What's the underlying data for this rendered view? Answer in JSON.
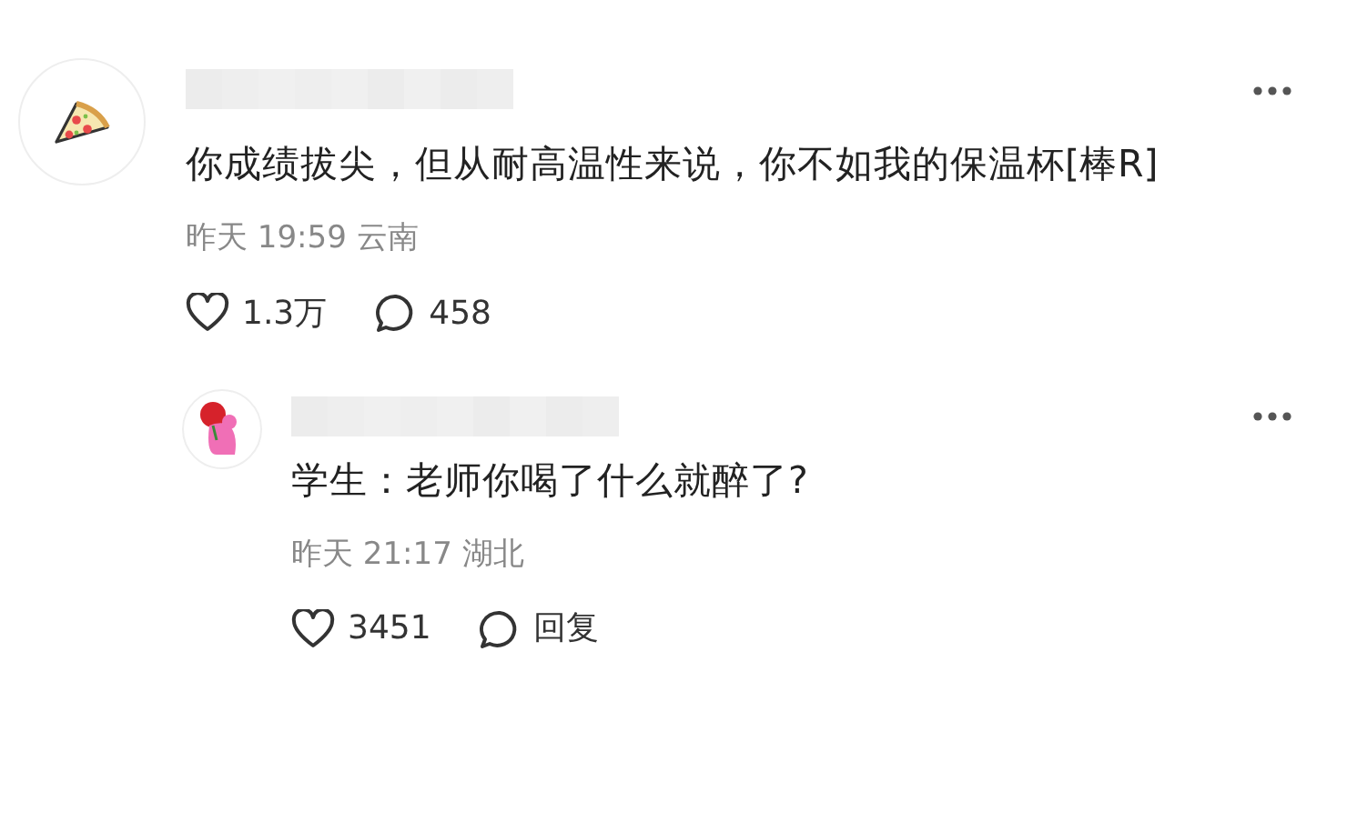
{
  "comments": [
    {
      "avatar": {
        "kind": "pizza"
      },
      "username": {
        "kind": "redacted"
      },
      "text": "你成绩拔尖，但从耐高温性来说，你不如我的保温杯[棒R]",
      "meta": "昨天 19:59 云南",
      "actions": [
        {
          "kind": "like",
          "label": "1.3万"
        },
        {
          "kind": "comment",
          "label": "458"
        }
      ],
      "replies": [
        {
          "avatar": {
            "kind": "rose"
          },
          "username": {
            "kind": "redacted"
          },
          "text": "学生：老师你喝了什么就醉了?",
          "meta": "昨天 21:17 湖北",
          "actions": [
            {
              "kind": "like",
              "label": "3451"
            },
            {
              "kind": "comment",
              "label": "回复"
            }
          ]
        }
      ]
    }
  ]
}
